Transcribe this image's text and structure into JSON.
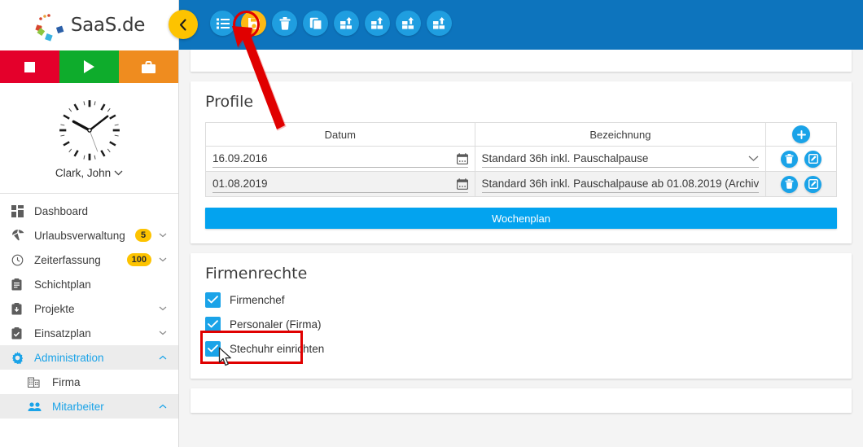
{
  "brand": {
    "name": "SaaS.de",
    "logo_icon": "saas-dots-logo"
  },
  "statusbar": {
    "buttons": [
      {
        "name": "stop-button",
        "icon": "stop-square-icon",
        "color": "#e4002b"
      },
      {
        "name": "play-button",
        "icon": "play-triangle-icon",
        "color": "#0eac2c"
      },
      {
        "name": "business-trip-button",
        "icon": "briefcase-icon",
        "color": "#ef8c1f"
      }
    ]
  },
  "user": {
    "name": "Clark, John",
    "caret_icon": "chevron-down-icon",
    "clock_icon": "analog-clock",
    "clock_time": "10:10"
  },
  "sidebar": {
    "items": [
      {
        "label": "Dashboard",
        "icon": "dashboard-grid-icon",
        "badge": "",
        "caret": "",
        "active": false,
        "sub": false
      },
      {
        "label": "Urlaubsverwaltung",
        "icon": "umbrella-icon",
        "badge": "5",
        "caret": "chevron-down-icon",
        "active": false,
        "sub": false
      },
      {
        "label": "Zeiterfassung",
        "icon": "clock-icon",
        "badge": "100",
        "caret": "chevron-down-icon",
        "active": false,
        "sub": false
      },
      {
        "label": "Schichtplan",
        "icon": "clipboard-icon",
        "badge": "",
        "caret": "",
        "active": false,
        "sub": false
      },
      {
        "label": "Projekte",
        "icon": "project-box-icon",
        "badge": "",
        "caret": "chevron-down-icon",
        "active": false,
        "sub": false
      },
      {
        "label": "Einsatzplan",
        "icon": "clipboard-check-icon",
        "badge": "",
        "caret": "chevron-down-icon",
        "active": false,
        "sub": false
      },
      {
        "label": "Administration",
        "icon": "gear-icon",
        "badge": "",
        "caret": "chevron-up-icon",
        "active": true,
        "sub": false
      },
      {
        "label": "Firma",
        "icon": "building-icon",
        "badge": "",
        "caret": "",
        "active": false,
        "sub": true
      },
      {
        "label": "Mitarbeiter",
        "icon": "people-icon",
        "badge": "",
        "caret": "chevron-up-icon",
        "active": true,
        "sub": true
      }
    ]
  },
  "header": {
    "background": "#0d74bd",
    "back_button": {
      "name": "back-button",
      "icon": "chevron-left-icon",
      "color": "#fdc300"
    },
    "tools": [
      {
        "name": "list-button",
        "icon": "list-icon",
        "accent": false
      },
      {
        "name": "save-button",
        "icon": "save-floppy-icon",
        "accent": true
      },
      {
        "name": "delete-button",
        "icon": "trash-icon",
        "accent": false
      },
      {
        "name": "copy-button",
        "icon": "copy-icon",
        "accent": false
      },
      {
        "name": "module-button-1",
        "icon": "grid-arrow-icon",
        "accent": false
      },
      {
        "name": "module-button-2",
        "icon": "grid-arrow-icon",
        "accent": false
      },
      {
        "name": "module-button-3",
        "icon": "grid-arrow-icon",
        "accent": false
      },
      {
        "name": "module-button-4",
        "icon": "grid-arrow-icon",
        "accent": false
      }
    ]
  },
  "profile_card": {
    "title": "Profile",
    "columns": {
      "date": "Datum",
      "desc": "Bezeichnung",
      "actions_add_icon": "plus-icon"
    },
    "rows": [
      {
        "date": "16.09.2016",
        "date_icon": "calendar-icon",
        "desc": "Standard 36h inkl. Pauschalpause",
        "desc_caret": "chevron-down-icon",
        "actions": [
          "trash-icon",
          "edit-icon"
        ]
      },
      {
        "date": "01.08.2019",
        "date_icon": "calendar-icon",
        "desc": "Standard 36h inkl. Pauschalpause ab 01.08.2019 (Archiv",
        "desc_caret": "",
        "actions": [
          "trash-icon",
          "edit-icon"
        ]
      }
    ],
    "weekplan_button": "Wochenplan"
  },
  "rights_card": {
    "title": "Firmenrechte",
    "checkboxes": [
      {
        "label": "Firmenchef",
        "checked": true,
        "highlighted": true
      },
      {
        "label": "Personaler (Firma)",
        "checked": true,
        "highlighted": false
      },
      {
        "label": "Stechuhr einrichten",
        "checked": true,
        "highlighted": false
      }
    ]
  },
  "colors": {
    "header_blue": "#0d74bd",
    "accent_yellow": "#fdc300",
    "icon_blue": "#1aa3e8",
    "button_blue": "#03a3ef",
    "highlight_red": "#e00000",
    "page_bg": "#f4f4f4"
  },
  "annotations": {
    "arrow_to_save": "red-arrow-pointing-to-save-button",
    "box_save": "red-highlight-box-save-button",
    "box_firmenchef": "red-highlight-box-firmenchef-checkbox",
    "mouse_cursor": "mouse-pointer-on-firmenchef-checkbox"
  }
}
